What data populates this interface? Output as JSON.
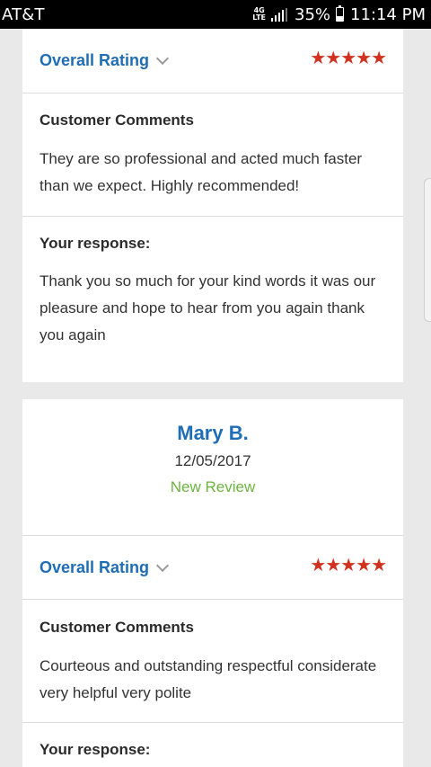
{
  "status_bar": {
    "carrier": "AT&T",
    "network_top": "4G",
    "network_bottom": "LTE",
    "signal_level": 0.75,
    "battery_percent": "35%",
    "battery_level": 0.35,
    "time": "11:14 PM"
  },
  "reviews": [
    {
      "overall_rating_label": "Overall Rating",
      "stars": "★★★★★",
      "rating": 5,
      "comments_title": "Customer Comments",
      "comments": "They are so professional and acted much faster than we expect. Highly recommended!",
      "response_title": "Your response:",
      "response": "Thank you so much for your kind words it was our pleasure and hope to hear from you again thank you again"
    },
    {
      "reviewer_name": "Mary B.",
      "date": "12/05/2017",
      "status": "New Review",
      "overall_rating_label": "Overall Rating",
      "stars": "★★★★★",
      "rating": 5,
      "comments_title": "Customer Comments",
      "comments": "Courteous and outstanding respectful considerate very helpful very polite",
      "response_title": "Your response:"
    }
  ],
  "colors": {
    "accent": "#1f6db5",
    "stars": "#d0321f",
    "new_review": "#6db33f",
    "background": "#e9e9e9"
  }
}
